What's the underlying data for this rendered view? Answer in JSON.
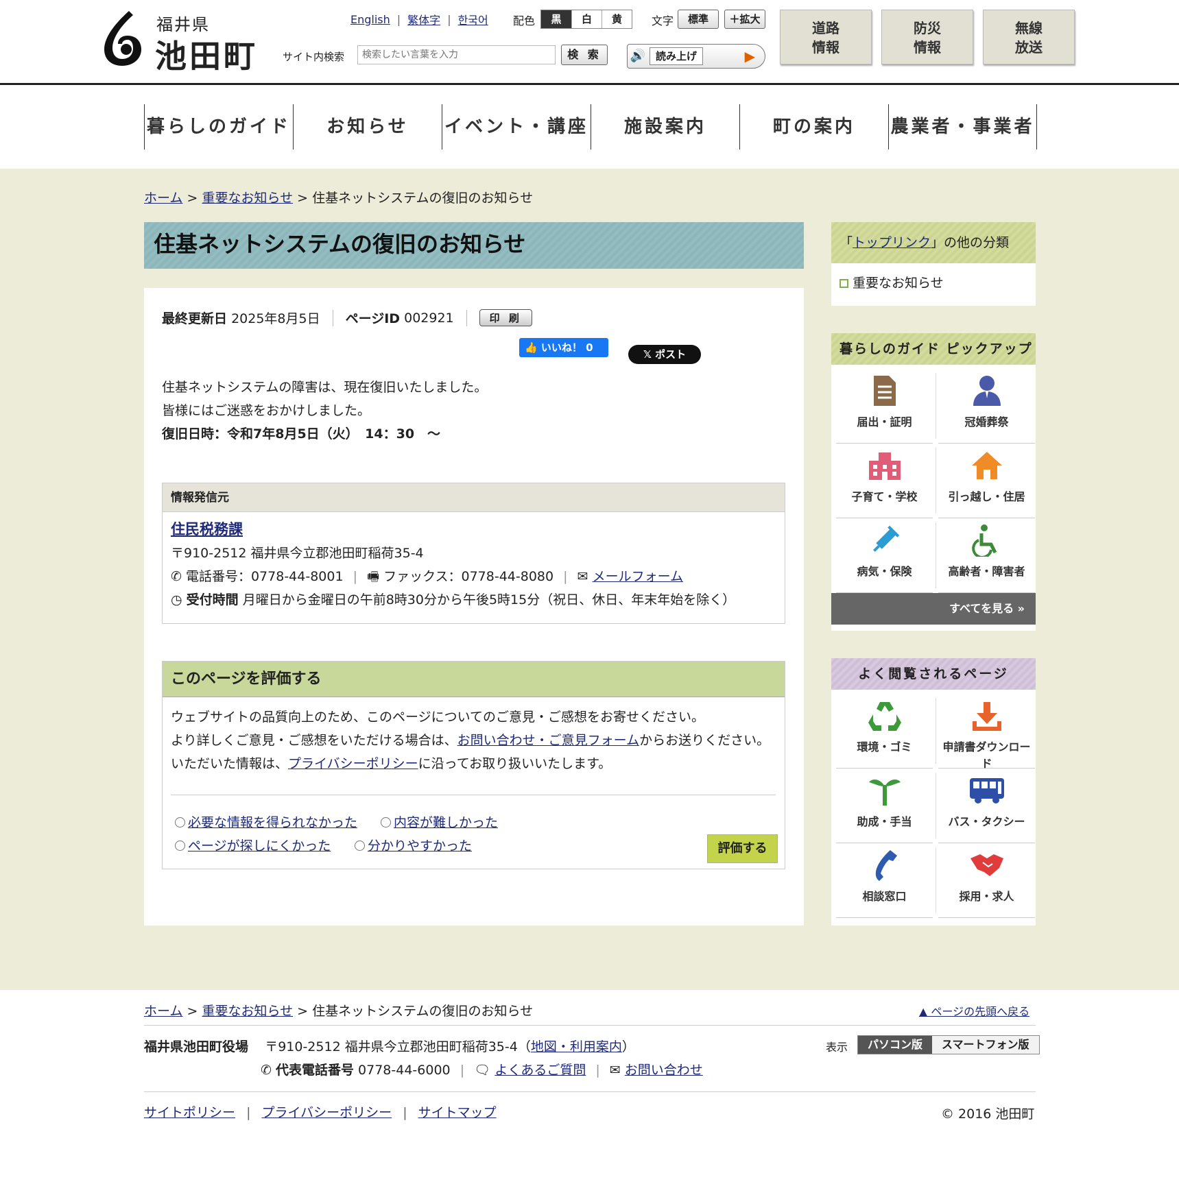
{
  "header": {
    "logo_sub": "福井県",
    "logo_main": "池田町",
    "languages": [
      "English",
      "繁体字",
      "한국어"
    ],
    "color_label": "配色",
    "color_options": [
      "黒",
      "白",
      "黄"
    ],
    "text_label": "文字",
    "text_standard": "標準",
    "text_enlarge": "＋拡大",
    "search_label": "サイト内検索",
    "search_placeholder": "検索したい言葉を入力",
    "search_button": "検 索",
    "read_aloud": "読み上げ",
    "big_buttons": [
      {
        "line1": "道路",
        "line2": "情報"
      },
      {
        "line1": "防災",
        "line2": "情報"
      },
      {
        "line1": "無線",
        "line2": "放送"
      }
    ]
  },
  "nav": [
    "暮らしのガイド",
    "お知らせ",
    "イベント・講座",
    "施設案内",
    "町の案内",
    "農業者・事業者"
  ],
  "breadcrumb": {
    "home": "ホーム",
    "sep": ">",
    "category": "重要なお知らせ",
    "current": "住基ネットシステムの復旧のお知らせ"
  },
  "article": {
    "title": "住基ネットシステムの復旧のお知らせ",
    "updated_label": "最終更新日",
    "updated_value": "2025年8月5日",
    "page_id_label": "ページID",
    "page_id_value": "002921",
    "print": "印 刷",
    "fb_like": "いいね！ 0",
    "x_post": "ポスト",
    "body_line1": "住基ネットシステムの障害は、現在復旧いたしました。",
    "body_line2": "皆様にはご迷惑をおかけしました。",
    "body_line3": "復旧日時：令和7年8月5日（火）　14：30　～"
  },
  "info": {
    "heading": "情報発信元",
    "dept": "住民税務課",
    "address": "〒910-2512 福井県今立郡池田町稲荷35-4",
    "phone": "電話番号：0778-44-8001",
    "fax": "ファックス：0778-44-8080",
    "mail": "メールフォーム",
    "hours_label": "受付時間",
    "hours": "月曜日から金曜日の午前8時30分から午後5時15分（祝日、休日、年末年始を除く）"
  },
  "rating": {
    "heading": "このページを評価する",
    "line1": "ウェブサイトの品質向上のため、このページについてのご意見・ご感想をお寄せください。",
    "line2_pre": "より詳しくご意見・ご感想をいただける場合は、",
    "line2_link": "お問い合わせ・ご意見フォーム",
    "line2_post": "からお送りください。",
    "line3_pre": "いただいた情報は、",
    "line3_link": "プライバシーポリシー",
    "line3_post": "に沿ってお取り扱いいたします。",
    "options": [
      "必要な情報を得られなかった",
      "内容が難しかった",
      "ページが探しにくかった",
      "分かりやすかった"
    ],
    "submit": "評価する"
  },
  "sidebar": {
    "toplink_pre": "「",
    "toplink_link": "トップリンク",
    "toplink_post": "」の他の分類",
    "toplink_item": "重要なお知らせ",
    "guide_heading": "暮らしのガイド ピックアップ",
    "guide_items": [
      "届出・証明",
      "冠婚葬祭",
      "子育て・学校",
      "引っ越し・住居",
      "病気・保険",
      "高齢者・障害者"
    ],
    "see_all": "すべてを見る »",
    "popular_heading": "よく閲覧されるページ",
    "popular_items": [
      "環境・ゴミ",
      "申請書ダウンロード",
      "助成・手当",
      "バス・タクシー",
      "相談窓口",
      "採用・求人"
    ]
  },
  "footer": {
    "back_to_top": "▲ ページの先頭へ戻る",
    "office": "福井県池田町役場",
    "address": "〒910-2512 福井県今立郡池田町稲荷35-4（",
    "map_link": "地図・利用案内",
    "address_close": "）",
    "tel_label": "代表電話番号",
    "tel": "0778-44-6000",
    "faq": "よくあるご質問",
    "contact": "お問い合わせ",
    "display_label": "表示",
    "pc_view": "パソコン版",
    "sp_view": "スマートフォン版",
    "links": [
      "サイトポリシー",
      "プライバシーポリシー",
      "サイトマップ"
    ],
    "copyright": "© 2016 池田町"
  },
  "colors": {
    "accent_title": "#93bdc0",
    "rating_header": "#c8d79a",
    "link": "#1f2b7a"
  }
}
